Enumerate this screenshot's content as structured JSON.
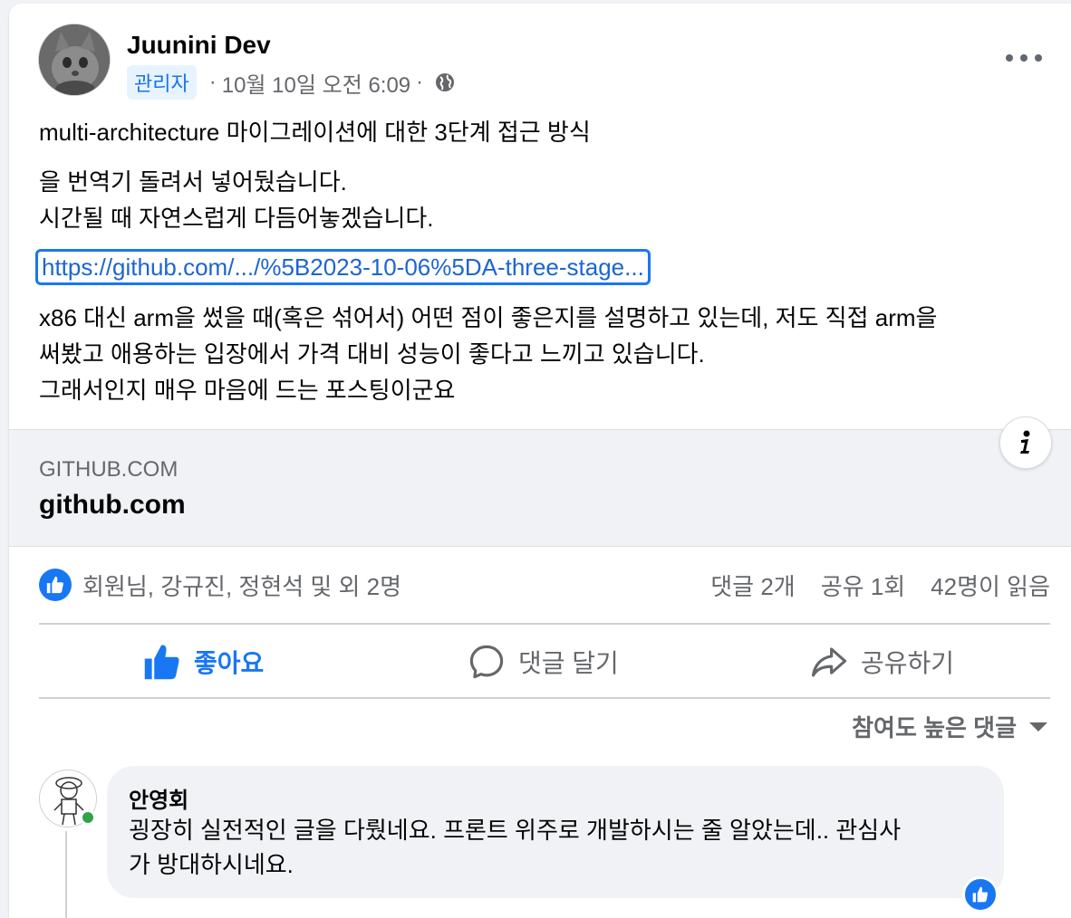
{
  "post": {
    "author": "Juunini Dev",
    "badge": "관리자",
    "timestamp": "10월 10일 오전 6:09",
    "separator": "·",
    "privacy_icon": "globe-icon",
    "title_line": "multi-architecture 마이그레이션에 대한 3단계 접근 방식",
    "body_line1": "을 번역기 돌려서 넣어뒀습니다.",
    "body_line2": "시간될 때 자연스럽게 다듬어놓겠습니다.",
    "link_text": "https://github.com/.../%5B2023-10-06%5DA-three-stage...",
    "body_line3": "x86 대신 arm을 썼을 때(혹은 섞어서) 어떤 점이 좋은지를 설명하고 있는데, 저도 직접 arm을",
    "body_line4": "써봤고 애용하는 입장에서 가격 대비 성능이 좋다고 느끼고 있습니다.",
    "body_line5": "그래서인지 매우 마음에 드는 포스팅이군요"
  },
  "preview": {
    "domain": "GITHUB.COM",
    "title": "github.com"
  },
  "reactions": {
    "summary": "회원님, 강규진, 정현석 및 외 2명",
    "comments": "댓글 2개",
    "shares": "공유 1회",
    "views": "42명이 읽음"
  },
  "actions": {
    "like": "좋아요",
    "comment": "댓글 달기",
    "share": "공유하기"
  },
  "sort": {
    "label": "참여도 높은 댓글"
  },
  "comment": {
    "name": "안영회",
    "text_line1": "굉장히 실전적인 글을 다뤘네요. 프론트 위주로 개발하시는 줄 알았는데.. 관심사",
    "text_line2": "가 방대하시네요."
  },
  "colors": {
    "brand_blue": "#1877f2",
    "link": "#1c65d3",
    "muted": "#65676b",
    "online": "#31a24c"
  }
}
